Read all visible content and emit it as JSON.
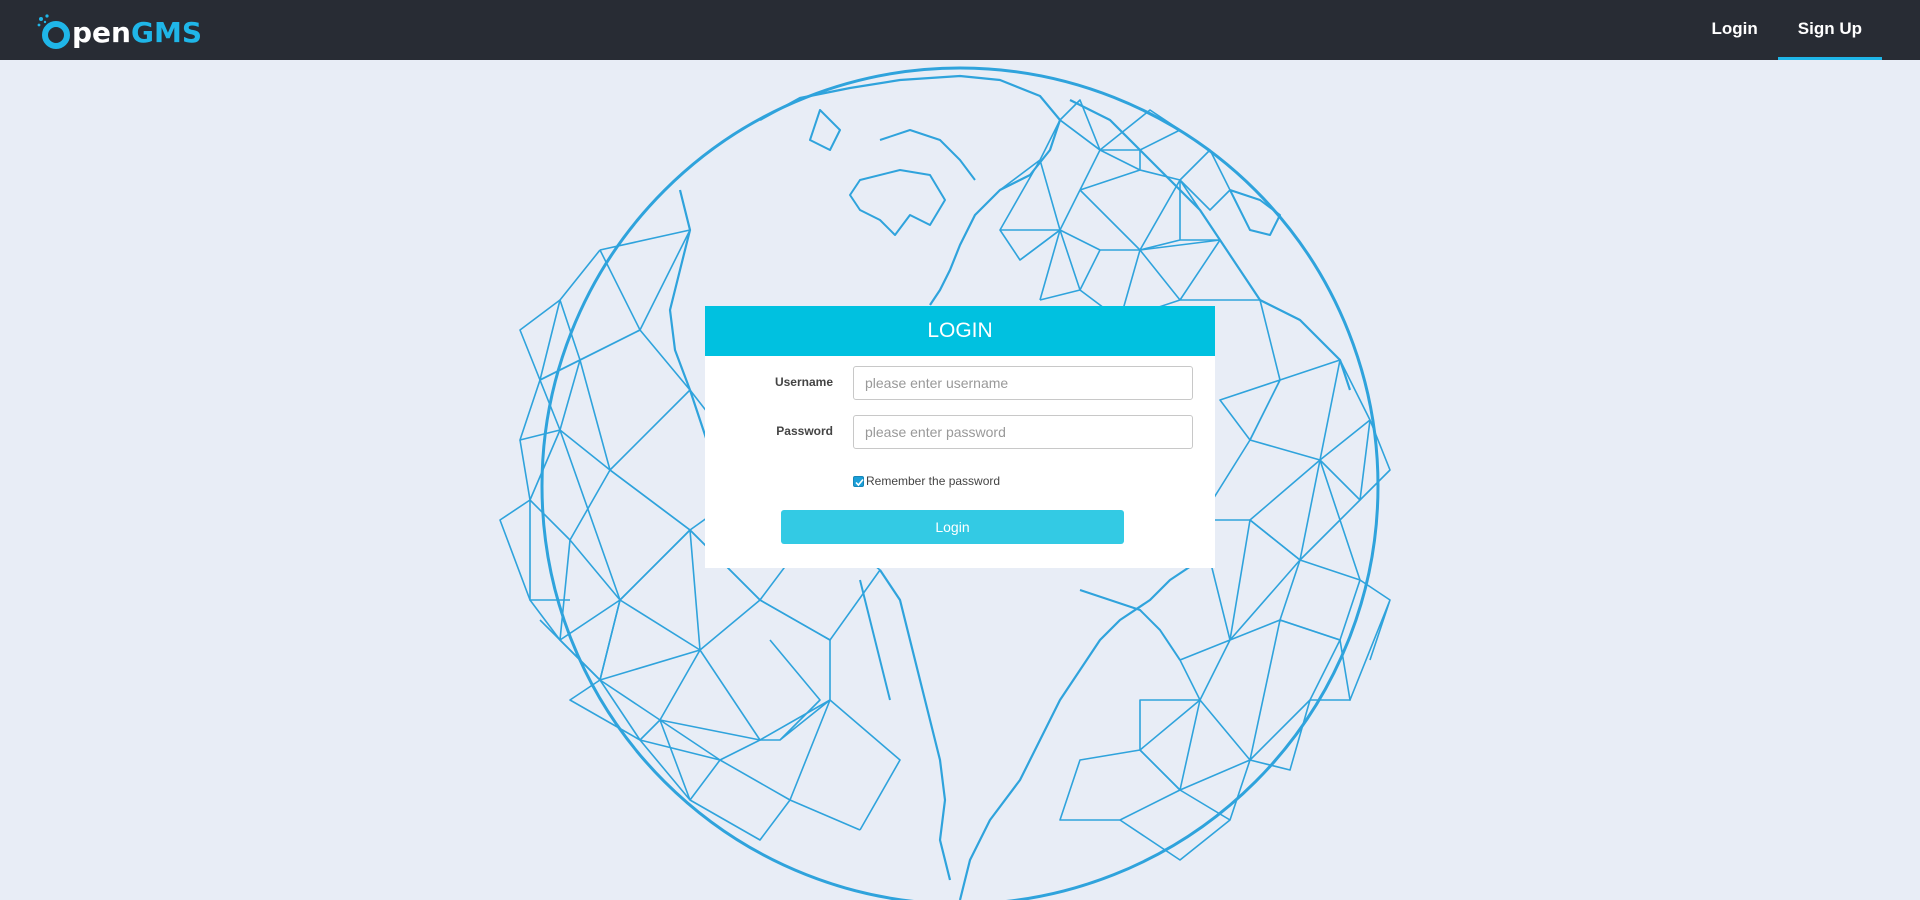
{
  "brand": {
    "logo_o": "O",
    "logo_pen": "pen",
    "logo_gms": "GMS",
    "accent_color": "#1fb6e8"
  },
  "nav": {
    "login": "Login",
    "signup": "Sign Up",
    "active": "signup"
  },
  "form": {
    "title": "LOGIN",
    "username_label": "Username",
    "username_placeholder": "please enter username",
    "username_value": "",
    "password_label": "Password",
    "password_placeholder": "please enter password",
    "password_value": "",
    "remember_label": "Remember the password",
    "remember_checked": true,
    "submit_label": "Login"
  },
  "colors": {
    "header_bg": "#282c34",
    "page_bg": "#e8edf6",
    "card_header": "#00c1e0",
    "button": "#33cae4",
    "globe_line": "#2fa3dc"
  },
  "icons": {
    "logo": "opengms-logo-icon",
    "background": "wireframe-globe-icon",
    "checkbox": "checkmark-icon"
  }
}
